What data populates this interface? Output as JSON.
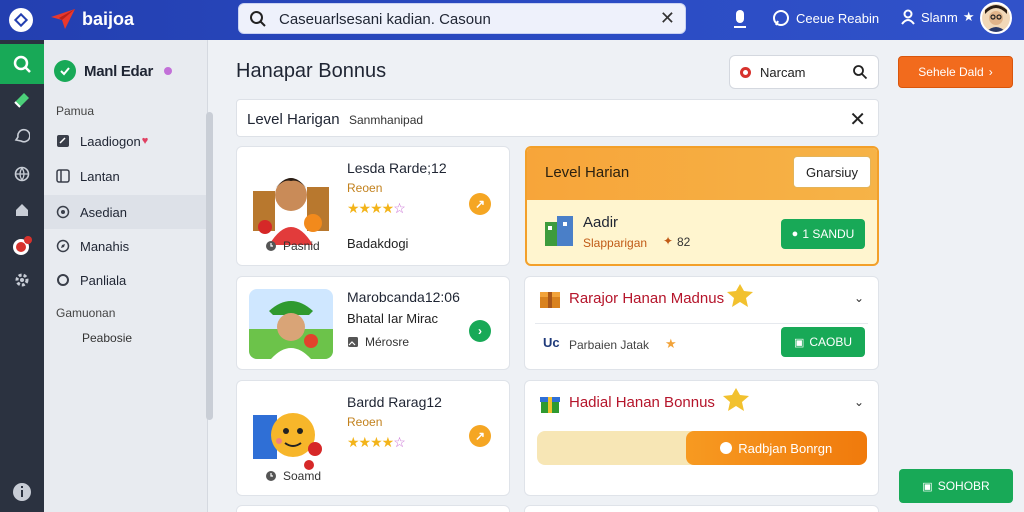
{
  "brand": {
    "name": "baijoa"
  },
  "search": {
    "value": "Caseuarlsesani kadian. Casoun"
  },
  "header": {
    "help_label": "Ceeue Reabin",
    "user_label": "Slanm"
  },
  "sidebar": {
    "username": "Manl Edar",
    "section_top": "Pamua",
    "items": [
      {
        "label": "Laadiogon"
      },
      {
        "label": "Lantan"
      },
      {
        "label": "Asedian"
      },
      {
        "label": "Manahis"
      },
      {
        "label": "Panliala"
      }
    ],
    "section_bottom": "Gamuonan",
    "sub_item": "Peabosie"
  },
  "main": {
    "title": "Hanapar Bonnus",
    "filter_label": "Narcam",
    "cta_label": "Sehele Dald",
    "subbar_title": "Level Harigan",
    "subbar_subtitle": "Sanmhanipad"
  },
  "cards": [
    {
      "title": "Lesda Rarde;12",
      "subtitle": "Reoen",
      "stars": 4,
      "foot_left": "Pasnid",
      "foot_right": "Badakdogi",
      "button_color": "#f5a623",
      "button_icon": "arrow-icon"
    },
    {
      "title": "Marobcanda12:06",
      "subtitle": "Bhatal Iar Mirac",
      "foot_left": "Mérosre",
      "button_color": "#18a957",
      "button_icon": "chevron-right-icon"
    },
    {
      "title": "Bardd Rarag12",
      "subtitle": "Reoen",
      "stars": 4,
      "foot_left": "Soamd",
      "button_color": "#f5a623",
      "button_icon": "arrow-icon"
    }
  ],
  "level_panel": {
    "title": "Level Harian",
    "button": "Gnarsiuy",
    "name": "Aadir",
    "sub": "Slapparigan",
    "number": "82",
    "green_button": "1 SANDU"
  },
  "accordions": [
    {
      "title": "Rarajor Hanan Madnus",
      "row_text": "Parbaien Jatak",
      "row_icon": "Uc",
      "button": "CAOBU"
    },
    {
      "title": "Hadial Hanan Bonnus",
      "progress_label": "Radbjan Bonrgn",
      "progress_percent": 55
    }
  ],
  "bottom_button": "SOHOBR",
  "colors": {
    "brand_blue": "#2b4cc4",
    "green": "#18a957",
    "orange": "#f26b1d",
    "rail": "#2b3240"
  }
}
